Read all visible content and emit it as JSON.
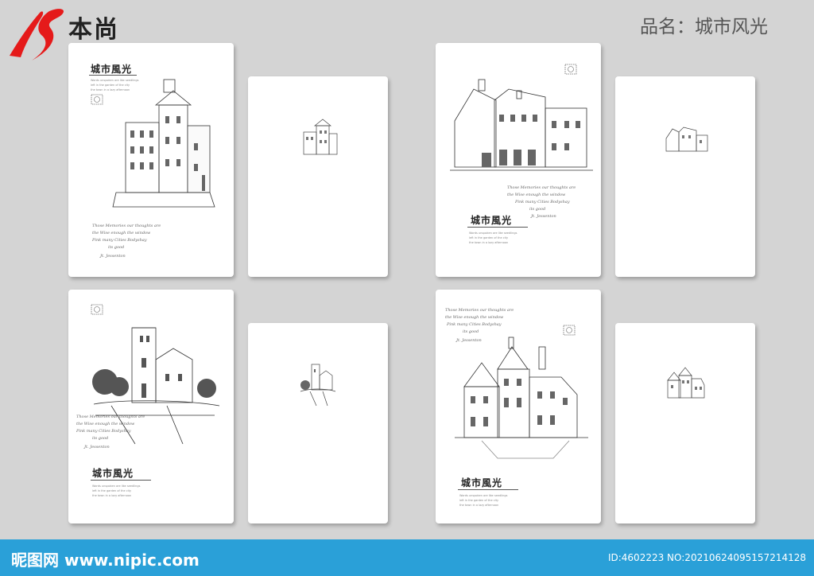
{
  "brand": {
    "name": "本尚",
    "logo_icon": "bs-logo-mark",
    "logo_color": "#e51a1a"
  },
  "header": {
    "product_label": "品名：城市风光"
  },
  "covers": [
    {
      "title": "城市風光",
      "caption": [
        "Words unspoken are like seedlings",
        "left in the garden of the city",
        "the town in a lazy afternoon"
      ],
      "script": [
        "Those Memories our thoughts are",
        "the Wise enough the window",
        "Pink many Cities Bodyshay",
        "its good",
        "Jt. Jessenton"
      ]
    },
    {
      "title": "城市風光",
      "caption": [
        "Words unspoken are like seedlings",
        "left in the garden of the city",
        "the town in a lazy afternoon"
      ],
      "script": [
        "Those Memories our thoughts are",
        "the Wise enough the window",
        "Pink many Cities Bodyshay",
        "its good",
        "Jt. Jessenton"
      ]
    },
    {
      "title": "城市風光",
      "caption": [
        "Words unspoken are like seedlings",
        "left in the garden of the city",
        "the town in a lazy afternoon"
      ],
      "script": [
        "Those Memories our thoughts are",
        "the Wise enough the window",
        "Pink many Cities Bodyshay",
        "its good",
        "Jt. Jessenton"
      ]
    },
    {
      "title": "城市風光",
      "caption": [
        "Words unspoken are like seedlings",
        "left in the garden of the city",
        "the town in a lazy afternoon"
      ],
      "script": [
        "Those Memories our thoughts are",
        "the Wise enough the window",
        "Pink many Cities Bodyshay",
        "its good",
        "Jt. Jessenton"
      ]
    }
  ],
  "footer": {
    "site": "昵图网 www.nipic.com",
    "id_text": "ID:4602223 NO:20210624095157214128",
    "color": "#2aa0d8"
  }
}
